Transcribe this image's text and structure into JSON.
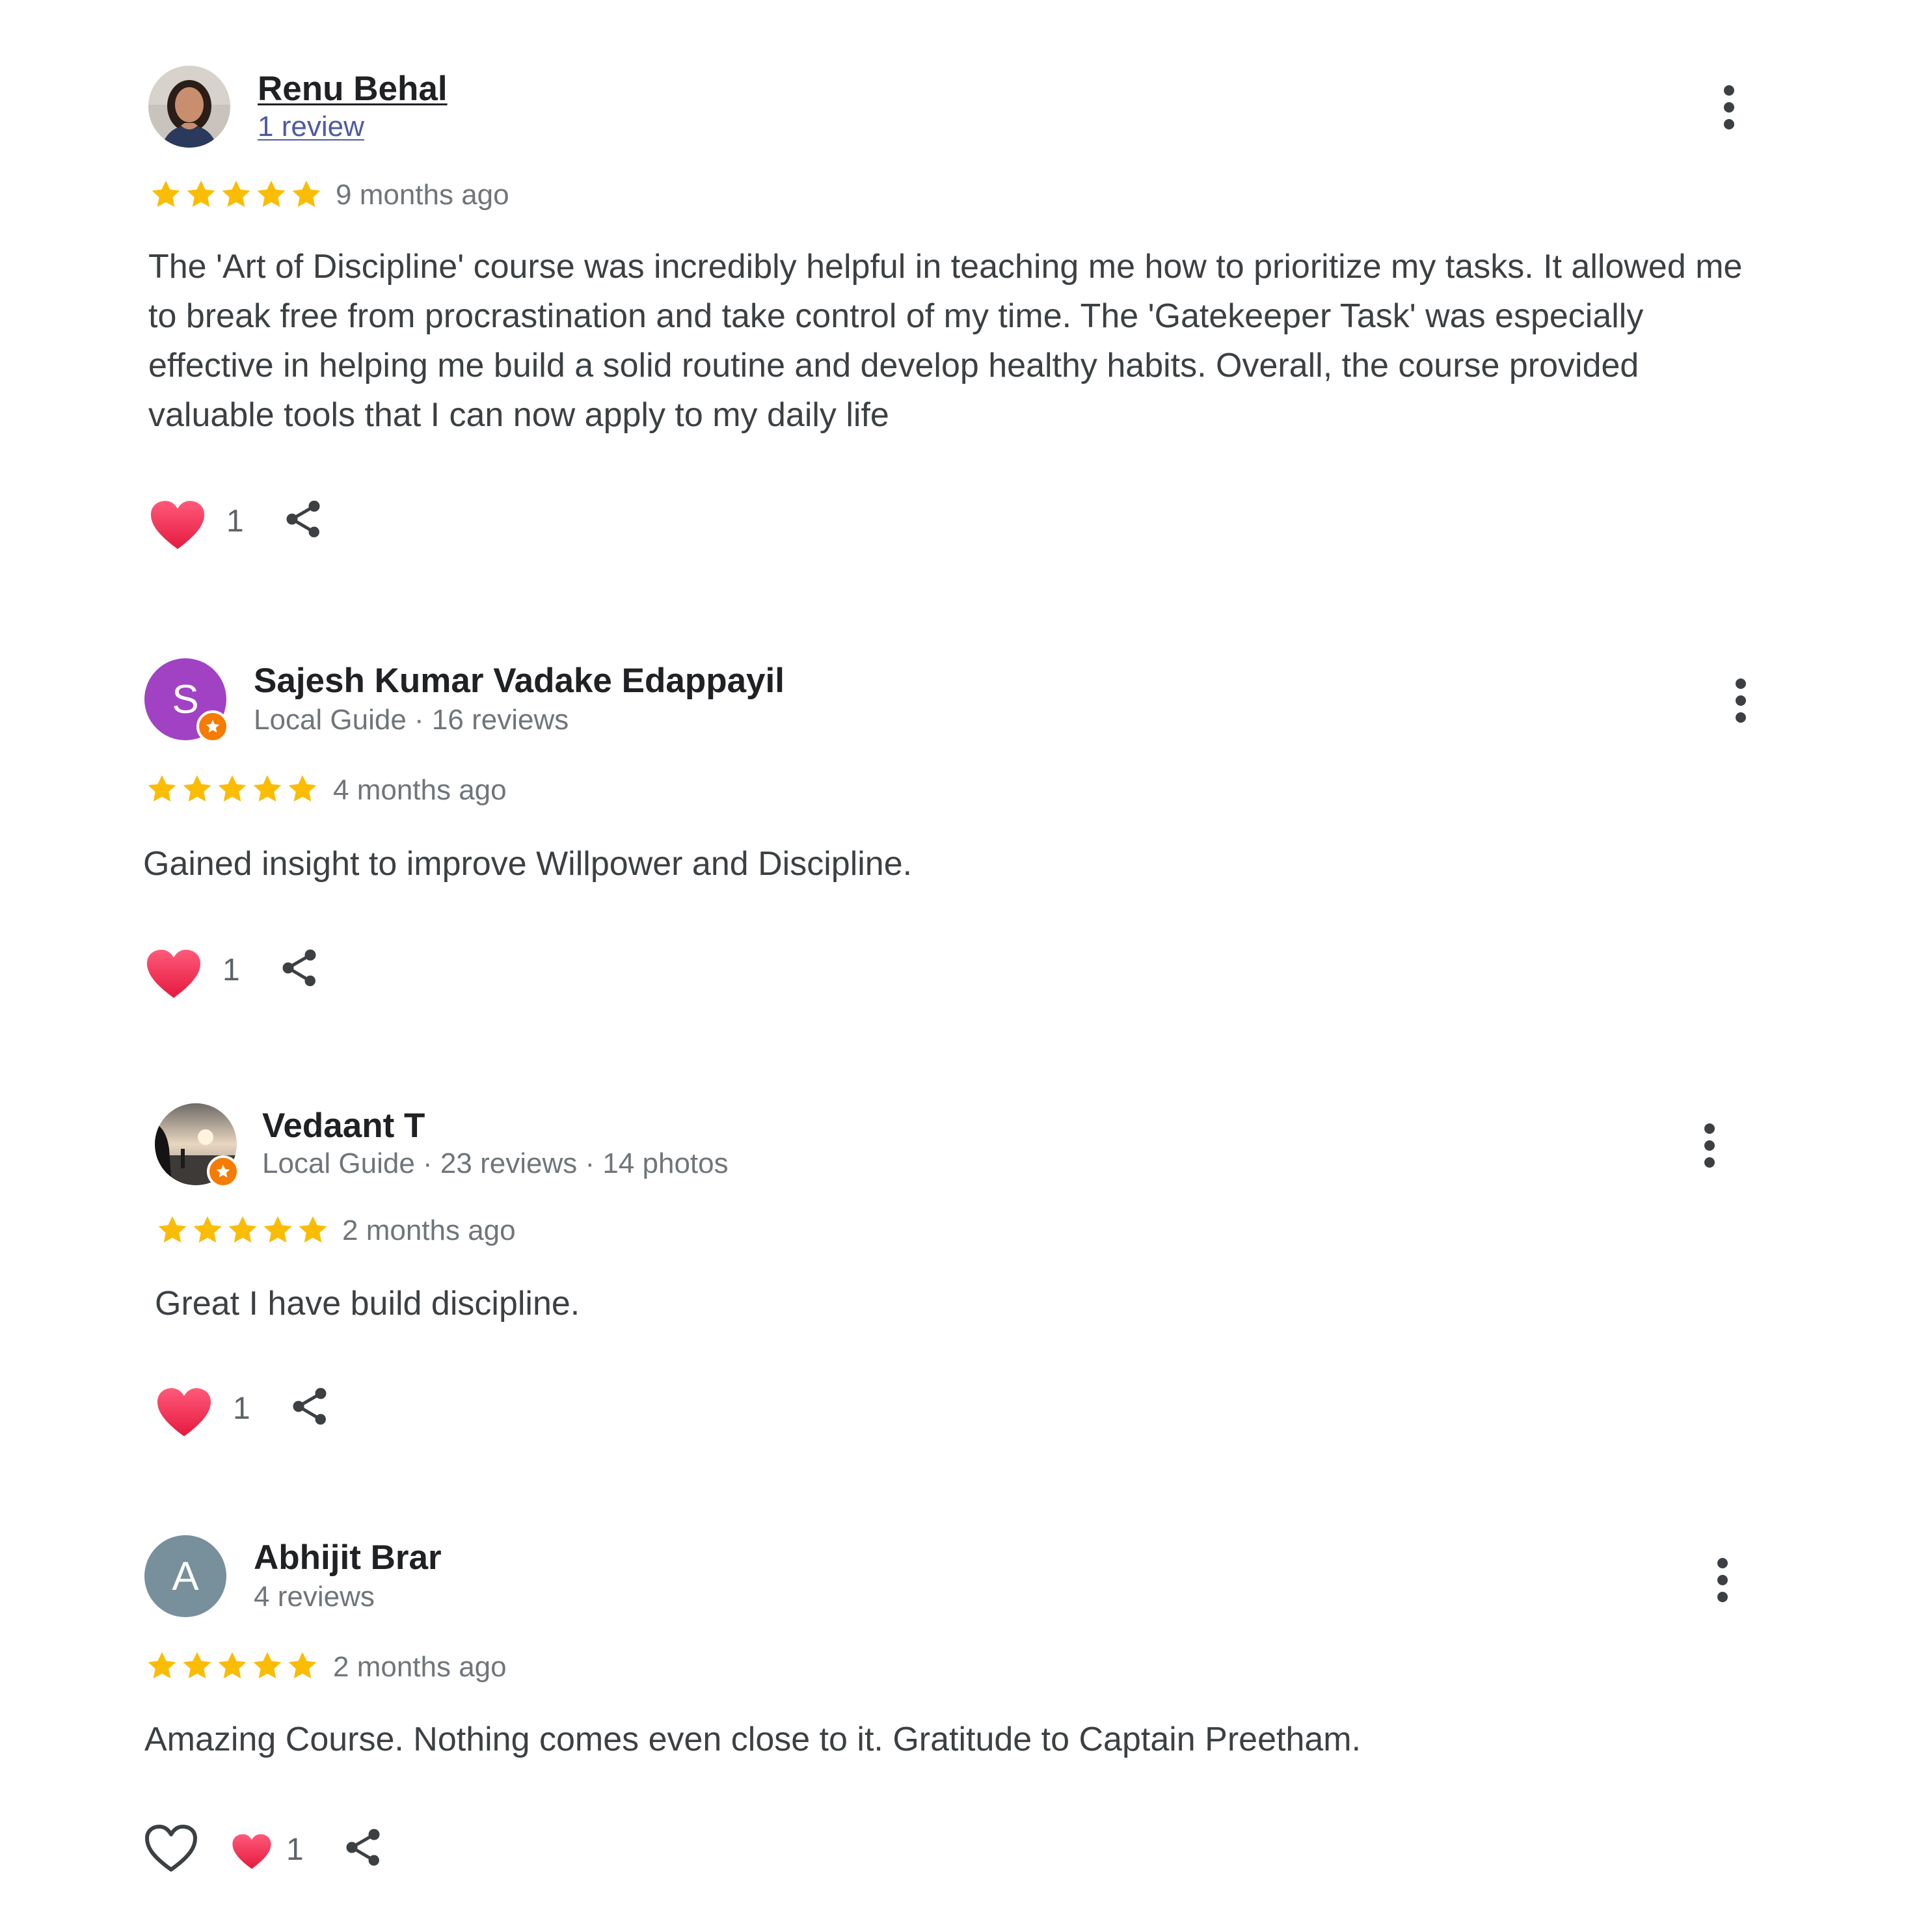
{
  "reviews": [
    {
      "name": "Renu Behal",
      "meta": "1 review",
      "rating": 5,
      "date": "9 months ago",
      "text": "The 'Art of Discipline' course was incredibly helpful in teaching me how to prioritize my tasks. It allowed me to break free from procrastination and take control of my time. The 'Gatekeeper Task' was especially effective in helping me build a solid routine and develop healthy habits. Overall, the course provided valuable tools that I can now apply to my daily life",
      "likes": "1",
      "avatar": "photo-woman"
    },
    {
      "name": "Sajesh Kumar Vadake Edappayil",
      "meta": "Local Guide · 16 reviews",
      "rating": 5,
      "date": "4 months ago",
      "text": "Gained insight to improve Willpower and Discipline.",
      "likes": "1",
      "avatar_letter": "S",
      "avatar_color": "#a142c4"
    },
    {
      "name": "Vedaant T",
      "meta": "Local Guide · 23 reviews · 14 photos",
      "rating": 5,
      "date": "2 months ago",
      "text": "Great I have build discipline.",
      "likes": "1",
      "avatar": "photo-sunset"
    },
    {
      "name": "Abhijit Brar",
      "meta": "4 reviews",
      "rating": 5,
      "date": "2 months ago",
      "text": "Amazing Course. Nothing comes even close to it. Gratitude to Captain Preetham.",
      "likes": "1",
      "avatar_letter": "A",
      "avatar_color": "#78909c"
    }
  ],
  "colors": {
    "star": "#fbbc04",
    "heart": "#f2335a",
    "local_guide_badge": "#f57c00",
    "name_text": "#202124",
    "meta_text": "#70757a",
    "body_text": "#3c4043"
  },
  "icons": [
    "more-vert-icon",
    "star-icon",
    "heart-filled-icon",
    "heart-outline-icon",
    "share-icon",
    "local-guide-badge-icon"
  ]
}
